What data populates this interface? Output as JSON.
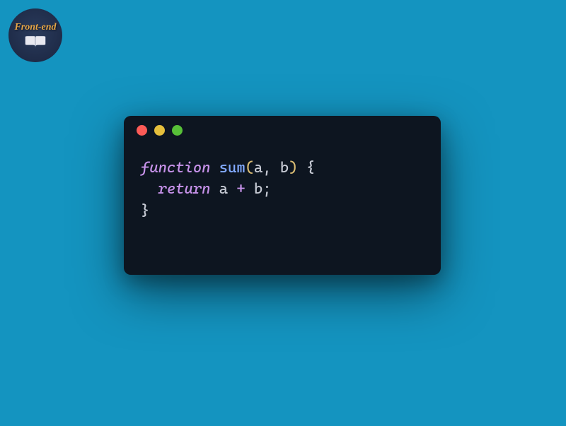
{
  "logo": {
    "text": "Front-end"
  },
  "window": {
    "title": ""
  },
  "code": {
    "line1": {
      "keyword": "function",
      "name": "sum",
      "paren_open": "(",
      "param1": "a",
      "comma": ", ",
      "param2": "b",
      "paren_close": ")",
      "brace_open": " {"
    },
    "line2": {
      "keyword": "return",
      "expr_a": " a ",
      "op": "+",
      "expr_b": " b",
      "semi": ";"
    },
    "line3": {
      "brace_close": "}"
    }
  },
  "colors": {
    "background": "#1494c0",
    "window_bg": "#0d1520",
    "dot_red": "#fc5b57",
    "dot_yellow": "#e5bf3c",
    "dot_green": "#57c038",
    "keyword": "#c792ea",
    "function_name": "#82aaff",
    "paren": "#d8bb73",
    "text": "#c5c9d3"
  }
}
